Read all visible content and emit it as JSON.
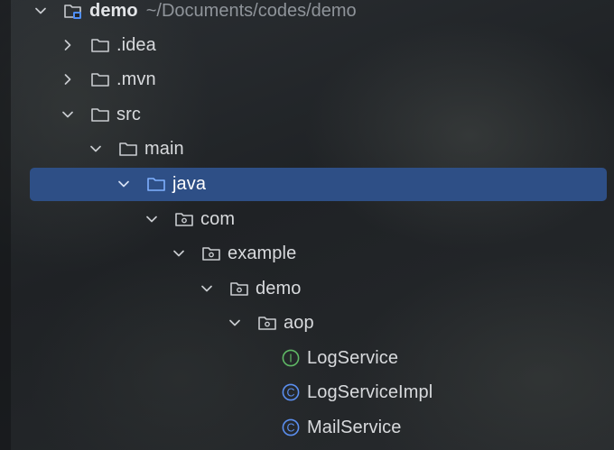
{
  "tree": {
    "rows": [
      {
        "label": "demo",
        "path": "~/Documents/codes/demo",
        "icon": "project-folder-icon",
        "chevron": "chevron-down-icon",
        "bold": true
      },
      {
        "label": ".idea",
        "icon": "folder-icon",
        "chevron": "chevron-right-icon"
      },
      {
        "label": ".mvn",
        "icon": "folder-icon",
        "chevron": "chevron-right-icon"
      },
      {
        "label": "src",
        "icon": "folder-icon",
        "chevron": "chevron-down-icon"
      },
      {
        "label": "main",
        "icon": "folder-icon",
        "chevron": "chevron-down-icon"
      },
      {
        "label": "java",
        "icon": "source-folder-icon",
        "chevron": "chevron-down-icon",
        "selected": true
      },
      {
        "label": "com",
        "icon": "package-icon",
        "chevron": "chevron-down-icon"
      },
      {
        "label": "example",
        "icon": "package-icon",
        "chevron": "chevron-down-icon"
      },
      {
        "label": "demo",
        "icon": "package-icon",
        "chevron": "chevron-down-icon"
      },
      {
        "label": "aop",
        "icon": "package-icon",
        "chevron": "chevron-down-icon"
      },
      {
        "label": "LogService",
        "icon": "interface-icon",
        "badge": "I"
      },
      {
        "label": "LogServiceImpl",
        "icon": "class-icon",
        "badge": "C"
      },
      {
        "label": "MailService",
        "icon": "class-icon",
        "badge": "C"
      }
    ]
  },
  "colors": {
    "selection": "#2e4f86",
    "interface_badge": "#5fb865",
    "class_badge": "#5b8ff0",
    "project_badge": "#4f8ef7",
    "icon_stroke": "#c9ccd0"
  }
}
